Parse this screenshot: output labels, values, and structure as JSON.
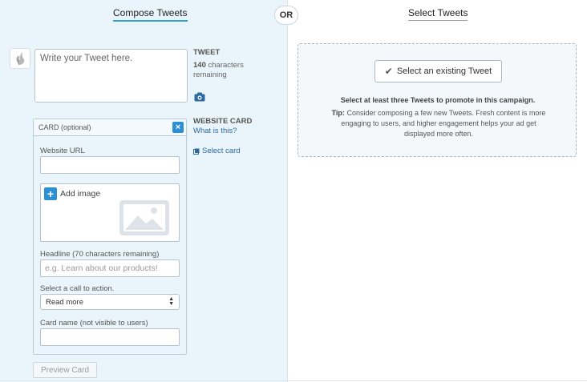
{
  "header": {
    "compose_title": "Compose Tweets",
    "or_label": "OR",
    "select_title": "Select Tweets"
  },
  "compose": {
    "placeholder": "Write your Tweet here.",
    "tweet_label": "TWEET",
    "chars_count": "140",
    "chars_text": " characters remaining",
    "website_card_label": "WEBSITE CARD",
    "what_is_this": "What is this?",
    "select_card": "Select card"
  },
  "card": {
    "title": "CARD (optional)",
    "close_symbol": "×",
    "website_url_label": "Website URL",
    "add_image": "Add image",
    "headline_label": "Headline (70 characters remaining)",
    "headline_placeholder": "e.g. Learn about our products!",
    "cta_label": "Select a call to action.",
    "cta_value": "Read more",
    "card_name_label": "Card name (not visible to users)"
  },
  "preview_button": "Preview Card",
  "select": {
    "button_label": "Select an existing Tweet",
    "bold_text": "Select at least three Tweets to promote in this campaign.",
    "tip_label": "Tip:",
    "tip_text": " Consider composing a few new Tweets. Fresh content is more engaging to users, and higher engagement helps your ad get displayed more often."
  },
  "colors": {
    "accent": "#2b8fd3",
    "left_bg": "#eaf4fb",
    "link": "#2b6a9e"
  }
}
